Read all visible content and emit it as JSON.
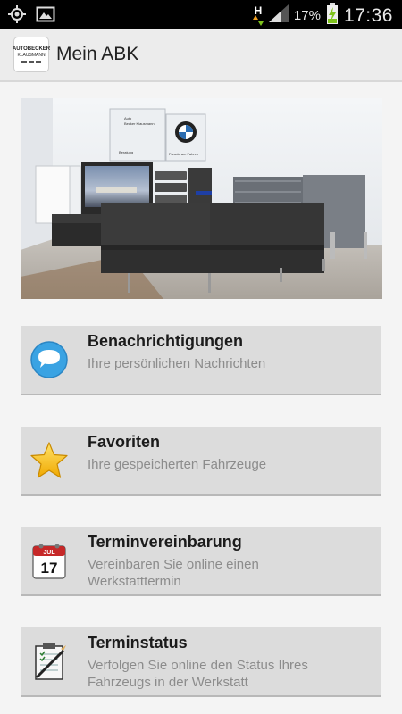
{
  "status_bar": {
    "icons_left": [
      "gps-icon",
      "image-icon"
    ],
    "network_type": "H",
    "battery_percent": "17%",
    "time": "17:36"
  },
  "action_bar": {
    "logo_text_line1": "AUTOBECKER",
    "logo_text_line2": "KLAUSMANN",
    "title": "Mein ABK"
  },
  "hero": {
    "sign_line1": "Auto",
    "sign_line2": "Becker Klausmann",
    "sign_line3": "Beratung",
    "sign_brand": "Freude am Fahren"
  },
  "menu": [
    {
      "title": "Benachrichtigungen",
      "subtitle": "Ihre persönlichen Nachrichten",
      "icon": "speech-bubble-icon"
    },
    {
      "title": "Favoriten",
      "subtitle": "Ihre gespeicherten Fahrzeuge",
      "icon": "star-icon"
    },
    {
      "title": "Terminvereinbarung",
      "subtitle": "Vereinbaren Sie online einen Werkstatttermin",
      "icon": "calendar-icon",
      "calendar_month": "JUL",
      "calendar_day": "17"
    },
    {
      "title": "Terminstatus",
      "subtitle": "Verfolgen Sie online den Status Ihres Fahrzeugs in der Werkstatt",
      "icon": "checklist-icon"
    }
  ],
  "colors": {
    "status_bar": "#000000",
    "action_bar": "#ececec",
    "menu_bg": "#dcdcdc",
    "bubble_blue": "#3aa3e3",
    "star_yellow": "#f6c21b",
    "battery_green": "#7fc31c"
  }
}
